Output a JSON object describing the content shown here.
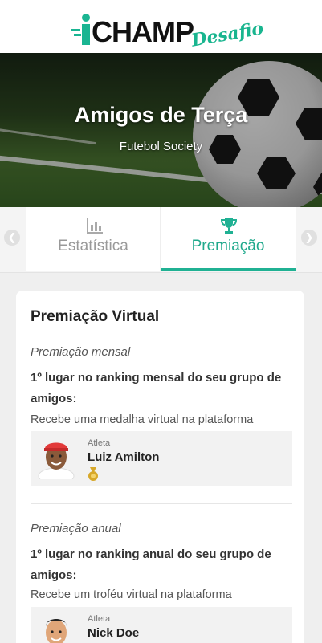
{
  "brand": {
    "name": "CHAMP",
    "tagline": "Desafio",
    "accent": "#20b193"
  },
  "hero": {
    "title": "Amigos de Terça",
    "subtitle": "Futebol Society"
  },
  "tabs": [
    {
      "label": "Estatística",
      "icon": "bar-chart-icon",
      "active": false
    },
    {
      "label": "Premiação",
      "icon": "trophy-icon",
      "active": true
    }
  ],
  "card": {
    "title": "Premiação Virtual",
    "sections": [
      {
        "heading": "Premiação mensal",
        "rank_text": "1º lugar no ranking mensal do seu grupo de amigos:",
        "description": "Recebe uma medalha virtual na plataforma",
        "athlete_label": "Atleta",
        "athlete_name": "Luiz Amilton",
        "award_icon": "medal-icon"
      },
      {
        "heading": "Premiação anual",
        "rank_text": "1º lugar no ranking anual do seu grupo de amigos:",
        "description": "Recebe um troféu virtual na plataforma",
        "athlete_label": "Atleta",
        "athlete_name": "Nick Doe",
        "award_icon": "trophy-icon"
      }
    ]
  }
}
